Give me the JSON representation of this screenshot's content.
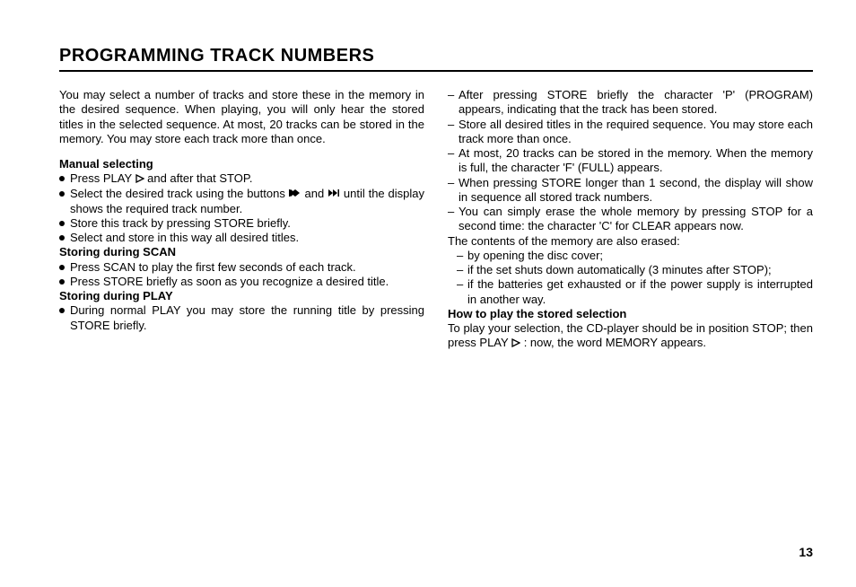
{
  "title": "PROGRAMMING TRACK NUMBERS",
  "page_number": "13",
  "left": {
    "intro": "You may select a number of tracks and store these in the memory in the desired sequence. When playing, you will only hear the stored titles in the selected sequence. At most, 20 tracks can be stored in the memory. You may store each track more than once.",
    "manual_heading": "Manual selecting",
    "manual_1a": "Press PLAY ",
    "manual_1b": " and after that STOP.",
    "manual_2a": "Select the desired track using the buttons ",
    "manual_2b": " and ",
    "manual_2c": " until the display shows the required track number.",
    "manual_3": "Store this track by pressing STORE briefly.",
    "manual_4": "Select and store in this way all desired titles.",
    "scan_heading": "Storing during SCAN",
    "scan_1": "Press SCAN to play the first few seconds of each track.",
    "scan_2": "Press STORE briefly as soon as you recognize a desired title.",
    "play_heading": "Storing during PLAY",
    "play_1": "During normal PLAY you may store the running title by pressing STORE briefly."
  },
  "right": {
    "p1": "After pressing STORE briefly the character 'P' (PROGRAM) appears, indicating that the track has been stored.",
    "p2": "Store all desired titles in the required sequence. You may store each track more than once.",
    "p3": "At most, 20 tracks can be stored in the memory. When the memory is full, the character 'F' (FULL) appears.",
    "p4": "When pressing STORE longer than 1 second, the display will show in sequence all stored track numbers.",
    "p5": "You can simply erase the whole memory by pressing STOP for a second time: the character 'C' for CLEAR appears now.",
    "erase_intro": "The contents of the memory are also erased:",
    "e1": "by opening the disc cover;",
    "e2": "if the set shuts down automatically (3 minutes after STOP);",
    "e3": "if the batteries get exhausted or if the power supply is interrupted in another way.",
    "howto_heading": "How to play the stored selection",
    "howto_a": "To play your selection, the CD-player should be in position STOP; then press PLAY ",
    "howto_b": ": now, the word MEMORY appears."
  }
}
